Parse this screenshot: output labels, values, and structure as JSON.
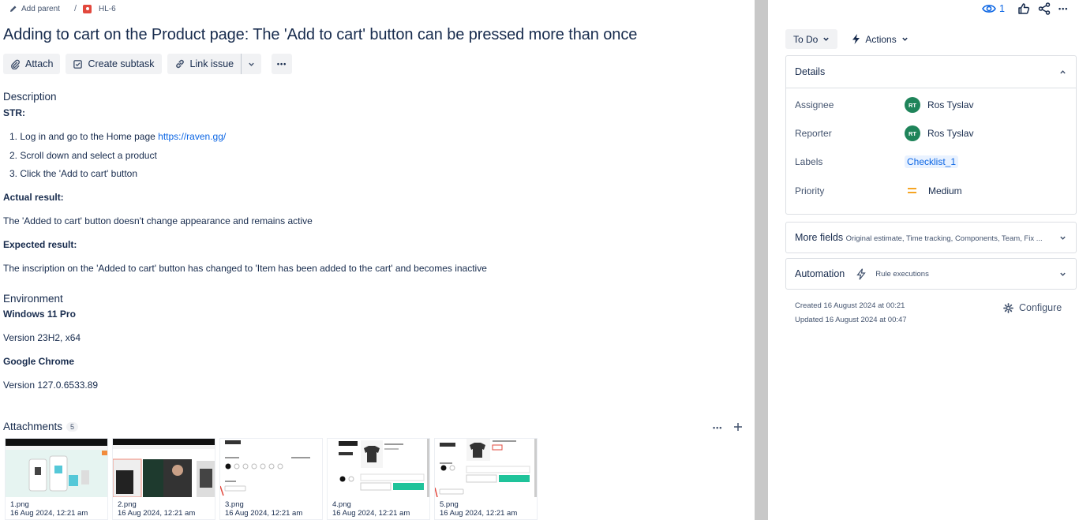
{
  "breadcrumb": {
    "add_parent": "Add parent",
    "separator": "/",
    "issue_key": "HL-6"
  },
  "title": "Adding to cart on the Product page: The 'Add to cart' button can be pressed more than once",
  "toolbar": {
    "attach": "Attach",
    "create_subtask": "Create subtask",
    "link_issue": "Link issue",
    "more": "•••"
  },
  "description": {
    "heading": "Description",
    "str_label": "STR:",
    "steps": [
      {
        "num": "1.",
        "text": "Log in and go to the Home page ",
        "link": "https://raven.gg/"
      },
      {
        "num": "2.",
        "text": "Scroll down and select a product"
      },
      {
        "num": "3.",
        "text": "Click the 'Add to cart' button"
      }
    ],
    "actual_label": "Actual result:",
    "actual_text": "The 'Added to cart' button doesn't change appearance and remains active",
    "expected_label": "Expected result:",
    "expected_text": "The inscription on the 'Added to cart' button has changed to 'Item has been added to the cart' and becomes inactive"
  },
  "environment": {
    "heading": "Environment",
    "os": "Windows 11 Pro",
    "os_version": "Version 23H2, x64",
    "browser": "Google Chrome",
    "browser_version": "Version 127.0.6533.89"
  },
  "attachments": {
    "heading": "Attachments",
    "count": "5",
    "items": [
      {
        "name": "1.png",
        "date": "16 Aug 2024, 12:21 am"
      },
      {
        "name": "2.png",
        "date": "16 Aug 2024, 12:21 am"
      },
      {
        "name": "3.png",
        "date": "16 Aug 2024, 12:21 am"
      },
      {
        "name": "4.png",
        "date": "16 Aug 2024, 12:21 am"
      },
      {
        "name": "5.png",
        "date": "16 Aug 2024, 12:21 am"
      }
    ]
  },
  "sidebar": {
    "watch_count": "1",
    "status": "To Do",
    "actions": "Actions",
    "details_heading": "Details",
    "assignee_label": "Assignee",
    "assignee_initials": "RT",
    "assignee_name": "Ros Tyslav",
    "reporter_label": "Reporter",
    "reporter_initials": "RT",
    "reporter_name": "Ros Tyslav",
    "labels_label": "Labels",
    "label_value": "Checklist_1",
    "priority_label": "Priority",
    "priority_value": "Medium",
    "more_fields": "More fields",
    "more_fields_hint": "Original estimate, Time tracking, Components, Team, Fix ...",
    "automation": "Automation",
    "rule_executions": "Rule executions",
    "created": "Created 16 August 2024 at 00:21",
    "updated": "Updated 16 August 2024 at 00:47",
    "configure": "Configure"
  },
  "colors": {
    "link": "#0c66e4",
    "bug": "#e2483d",
    "avatar": "#1f845a",
    "priority_medium": "#f5a524"
  }
}
